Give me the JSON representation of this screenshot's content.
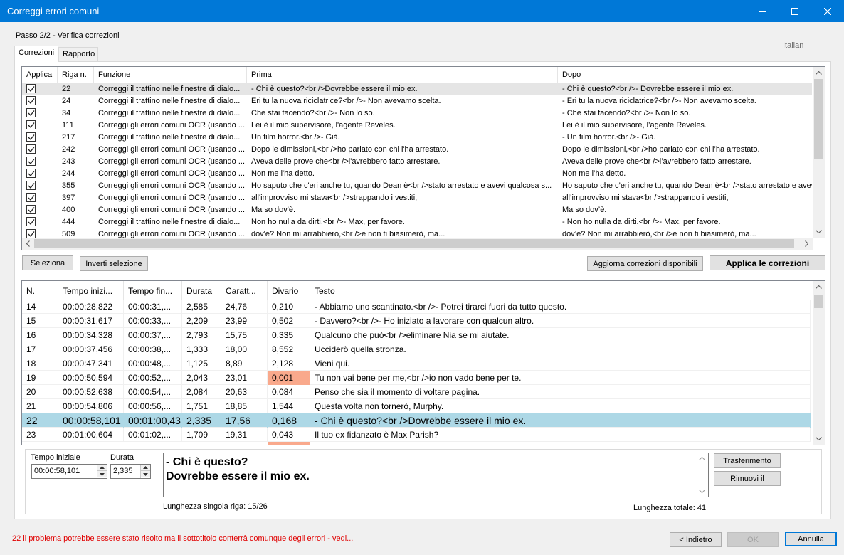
{
  "window": {
    "title": "Correggi errori comuni",
    "step": "Passo 2/2 - Verifica correzioni",
    "language": "Italian",
    "accent_color": "#0078d7"
  },
  "tabs": [
    {
      "label": "Correzioni",
      "active": true
    },
    {
      "label": "Rapporto",
      "active": false
    }
  ],
  "fixes_grid": {
    "columns": [
      "Applica",
      "Riga n.",
      "Funzione",
      "Prima",
      "Dopo"
    ],
    "rows": [
      {
        "applied": true,
        "line": "22",
        "function": "Correggi il trattino nelle finestre di dialo...",
        "before": "- Chi è questo?<br />Dovrebbe essere il mio ex.",
        "after": "- Chi è questo?<br />- Dovrebbe essere il mio ex."
      },
      {
        "applied": true,
        "line": "24",
        "function": "Correggi il trattino nelle finestre di dialo...",
        "before": "Eri tu la nuova riciclatrice?<br />- Non avevamo scelta.",
        "after": "- Eri tu la nuova riciclatrice?<br />- Non avevamo scelta."
      },
      {
        "applied": true,
        "line": "34",
        "function": "Correggi il trattino nelle finestre di dialo...",
        "before": "Che stai facendo?<br />- Non lo so.",
        "after": "- Che stai facendo?<br />- Non lo so."
      },
      {
        "applied": true,
        "line": "111",
        "function": "Correggi gli errori comuni OCR (usando ...",
        "before": "Lei è il mio supervisore, l'agente Reveles.",
        "after": "Lei è il mio supervisore, l’agente Reveles."
      },
      {
        "applied": true,
        "line": "217",
        "function": "Correggi il trattino nelle finestre di dialo...",
        "before": "Un film horror.<br />- Già.",
        "after": "- Un film horror.<br />- Già."
      },
      {
        "applied": true,
        "line": "242",
        "function": "Correggi gli errori comuni OCR (usando ...",
        "before": "Dopo le dimissioni,<br />ho parlato con chi l'ha arrestato.",
        "after": "Dopo le dimissioni,<br />ho parlato con chi l’ha arrestato."
      },
      {
        "applied": true,
        "line": "243",
        "function": "Correggi gli errori comuni OCR (usando ...",
        "before": "Aveva delle prove che<br />l'avrebbero fatto arrestare.",
        "after": "Aveva delle prove che<br />l’avrebbero fatto arrestare."
      },
      {
        "applied": true,
        "line": "244",
        "function": "Correggi gli errori comuni OCR (usando ...",
        "before": "Non me l'ha detto.",
        "after": "Non me l’ha detto."
      },
      {
        "applied": true,
        "line": "355",
        "function": "Correggi gli errori comuni OCR (usando ...",
        "before": "Ho saputo che c'eri anche tu, quando Dean è<br />stato arrestato e avevi qualcosa s...",
        "after": "Ho saputo che c’eri anche tu, quando Dean è<br />stato arrestato e avevi"
      },
      {
        "applied": true,
        "line": "397",
        "function": "Correggi gli errori comuni OCR (usando ...",
        "before": "all'improvviso mi stava<br />strappando i vestiti,",
        "after": "all’improvviso mi stava<br />strappando i vestiti,"
      },
      {
        "applied": true,
        "line": "400",
        "function": "Correggi gli errori comuni OCR (usando ...",
        "before": "Ma so dov'è.",
        "after": "Ma so dov’è."
      },
      {
        "applied": true,
        "line": "444",
        "function": "Correggi il trattino nelle finestre di dialo...",
        "before": "Non ho nulla da dirti.<br />- Max, per favore.",
        "after": "- Non ho nulla da dirti.<br />- Max, per favore."
      },
      {
        "applied": true,
        "line": "509",
        "function": "Correggi gli errori comuni OCR (usando ...",
        "before": "dov'è? Non mi arrabbierò,<br />e non ti biasimerò, ma...",
        "after": "dov’è? Non mi arrabbierò,<br />e non ti biasimerò, ma..."
      }
    ]
  },
  "buttons": {
    "select": "Seleziona",
    "invert": "Inverti selezione",
    "refresh": "Aggiorna correzioni disponibili",
    "apply": "Applica le correzioni",
    "transfer": "Trasferimento",
    "remove": "Rimuovi il",
    "back": "< Indietro",
    "ok": "OK",
    "cancel": "Annulla"
  },
  "subtitle_grid": {
    "columns": [
      "N.",
      "Tempo inizi...",
      "Tempo fin...",
      "Durata",
      "Caratt...",
      "Divario",
      "Testo"
    ],
    "rows": [
      {
        "n": "14",
        "start": "00:00:28,822",
        "end": "00:00:31,...",
        "duration": "2,585",
        "chars": "24,76",
        "gap": "0,210",
        "text": "- Abbiamo uno scantinato.<br />- Potrei tirarci fuori da tutto questo.",
        "warn": false
      },
      {
        "n": "15",
        "start": "00:00:31,617",
        "end": "00:00:33,...",
        "duration": "2,209",
        "chars": "23,99",
        "gap": "0,502",
        "text": "- Davvero?<br />- Ho iniziato a lavorare con qualcun altro.",
        "warn": false
      },
      {
        "n": "16",
        "start": "00:00:34,328",
        "end": "00:00:37,...",
        "duration": "2,793",
        "chars": "15,75",
        "gap": "0,335",
        "text": "Qualcuno che può<br />eliminare Nia se mi aiutate.",
        "warn": false
      },
      {
        "n": "17",
        "start": "00:00:37,456",
        "end": "00:00:38,...",
        "duration": "1,333",
        "chars": "18,00",
        "gap": "8,552",
        "text": "Ucciderò quella stronza.",
        "warn": false
      },
      {
        "n": "18",
        "start": "00:00:47,341",
        "end": "00:00:48,...",
        "duration": "1,125",
        "chars": "8,89",
        "gap": "2,128",
        "text": "Vieni qui.",
        "warn": false
      },
      {
        "n": "19",
        "start": "00:00:50,594",
        "end": "00:00:52,...",
        "duration": "2,043",
        "chars": "23,01",
        "gap": "0,001",
        "text": "Tu non vai bene per me,<br />io non vado bene per te.",
        "warn": true
      },
      {
        "n": "20",
        "start": "00:00:52,638",
        "end": "00:00:54,...",
        "duration": "2,084",
        "chars": "20,63",
        "gap": "0,084",
        "text": "Penso che sia il momento di voltare pagina.",
        "warn": false
      },
      {
        "n": "21",
        "start": "00:00:54,806",
        "end": "00:00:56,...",
        "duration": "1,751",
        "chars": "18,85",
        "gap": "1,544",
        "text": "Questa volta non tornerò, Murphy.",
        "warn": false
      },
      {
        "n": "22",
        "start": "00:00:58,101",
        "end": "00:01:00,43",
        "duration": "2,335",
        "chars": "17,56",
        "gap": "0,168",
        "text": "- Chi è questo?<br />Dovrebbe essere il mio ex.",
        "warn": false
      },
      {
        "n": "23",
        "start": "00:01:00,604",
        "end": "00:01:02,...",
        "duration": "1,709",
        "chars": "19,31",
        "gap": "0,043",
        "text": "Il tuo ex fidanzato è Max Parish?",
        "warn": false
      }
    ]
  },
  "editor": {
    "start_label": "Tempo iniziale",
    "start_value": "00:00:58,101",
    "duration_label": "Durata",
    "duration_value": "2,335",
    "text_lines": [
      "- Chi è questo?",
      "Dovrebbe essere il mio ex."
    ],
    "single_line_length": "Lunghezza singola riga: 15/26",
    "total_length": "Lunghezza totale: 41"
  },
  "status_message": "22 il problema potrebbe essere stato risolto ma il sottotitolo conterrà comunque degli errori - vedi...",
  "colors": {
    "selected_row": "#add8e6",
    "warn_cell": "#f9a98c",
    "status_text": "#e00000"
  }
}
